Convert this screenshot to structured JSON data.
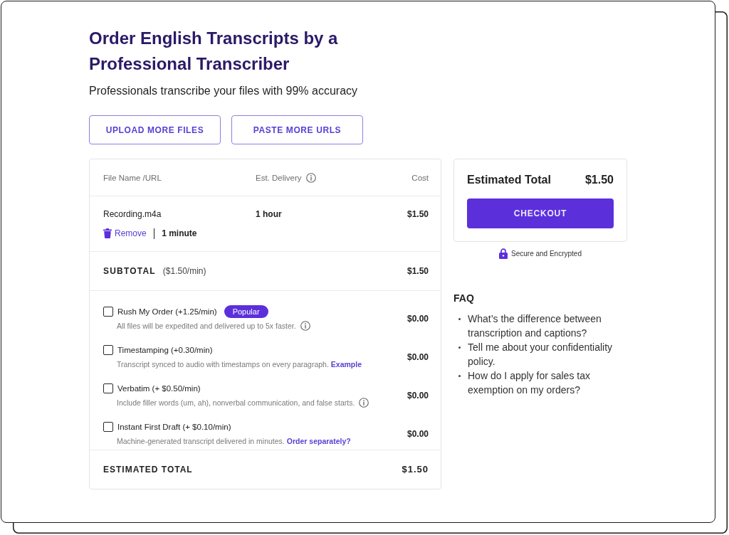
{
  "title": "Order English Transcripts by a Professional Transcriber",
  "subtitle": "Professionals transcribe your files with 99% accuracy",
  "buttons": [
    "UPLOAD MORE FILES",
    "PASTE MORE URLS"
  ],
  "table": {
    "columns": [
      {
        "label": "File Name /URL",
        "info": false
      },
      {
        "label": "Est. Delivery",
        "info": true
      },
      {
        "label": "Cost",
        "info": false
      }
    ],
    "files": [
      {
        "name": "Recording.m4a",
        "remove": "Remove",
        "duration": "1 minute",
        "delivery": "1 hour",
        "cost": "$1.50"
      }
    ],
    "subtotal": {
      "label": "SUBTOTAL",
      "rate": "($1.50/min)",
      "value": "$1.50"
    },
    "options": [
      {
        "label": "Rush My Order (+1.25/min)",
        "badge": "Popular",
        "description": "All files will be expedited and delivered up to 5x faster.",
        "info": true,
        "checked": false,
        "price": "$0.00"
      },
      {
        "label": "Timestamping (+0.30/min)",
        "description": "Transcript synced to audio with timestamps on every paragraph.",
        "link": "Example",
        "info": false,
        "checked": false,
        "price": "$0.00"
      },
      {
        "label": "Verbatim (+ $0.50/min)",
        "description": "Include filler words (um, ah), nonverbal communication, and false starts.",
        "info": true,
        "checked": false,
        "price": "$0.00"
      },
      {
        "label": "Instant First Draft (+ $0.10/min)",
        "description": "Machine-generated transcript delivered in minutes.",
        "link": "Order separately?",
        "info": false,
        "checked": false,
        "price": "$0.00"
      }
    ],
    "total": {
      "label": "ESTIMATED TOTAL",
      "value": "$1.50"
    }
  },
  "summary": {
    "label": "Estimated Total",
    "value": "$1.50",
    "button": "CHECKOUT",
    "secure_note": "Secure and Encrypted"
  },
  "faq": {
    "title": "FAQ",
    "items": [
      "What’s the difference between transcription and captions?",
      "Tell me about your confidentiality policy.",
      "How do I apply for sales tax exemption on my orders?"
    ]
  }
}
